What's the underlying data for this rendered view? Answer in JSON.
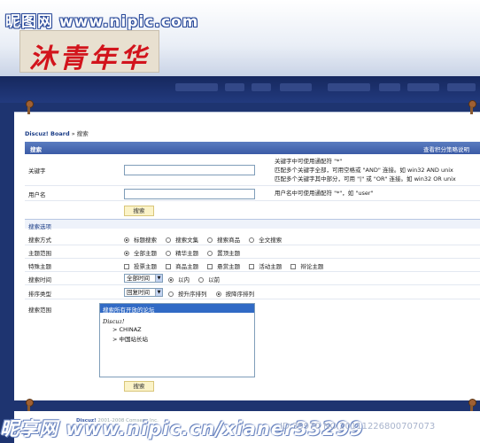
{
  "watermark": {
    "top": "昵图网 www.nipic.com",
    "bottom": "昵享网 www.nipic.cn/xianer33299",
    "id": "ID:35970 NO.20111226800707073"
  },
  "logo": {
    "text": "沐青年华"
  },
  "breadcrumb": {
    "board": "Discuz! Board",
    "sep": "»",
    "current": "搜索"
  },
  "header": {
    "title": "搜索",
    "right_link": "查看积分策略说明"
  },
  "keyword": {
    "label": "关键字",
    "value": "",
    "hint_line1": "关键字中可使用通配符 \"*\"",
    "hint_line2_a": "匹配多个关键字全部，可用空格或 \"AND\" 连接。如 win32 AND unix",
    "hint_line3_a": "匹配多个关键字其中部分，可用 \"|\" 或 \"OR\" 连接。如 win32 OR unix"
  },
  "username": {
    "label": "用户名",
    "value": "",
    "hint": "用户名中可使用通配符 \"*\"，如 \"user\""
  },
  "search_button": "搜索",
  "section_options": "搜索选项",
  "search_mode": {
    "label": "搜索方式",
    "options": [
      "标题搜索",
      "搜索文集",
      "搜索商品",
      "全文搜索"
    ],
    "selected": 0
  },
  "topic_scope": {
    "label": "主题范围",
    "options": [
      "全部主题",
      "精华主题",
      "置顶主题"
    ],
    "selected": 0
  },
  "special_topics": {
    "label": "特殊主题",
    "options": [
      "投票主题",
      "商品主题",
      "悬赏主题",
      "活动主题",
      "辩论主题"
    ]
  },
  "search_time": {
    "label": "搜索时间",
    "select_value": "全部时间",
    "options": [
      "以内",
      "以前"
    ],
    "selected": 0
  },
  "sort_type": {
    "label": "排序类型",
    "select_value": "回复时间",
    "options": [
      "按升序排列",
      "按降序排列"
    ],
    "selected": 1
  },
  "search_range": {
    "label": "搜索范围",
    "selected_item": "搜索所有开放的论坛",
    "group": "Discuz!",
    "items": [
      "> CHINAZ",
      "> 中国站长站"
    ]
  },
  "footer": {
    "text_a": "Discuz!",
    "text_b": "2001-2008 Comsenz Inc."
  }
}
